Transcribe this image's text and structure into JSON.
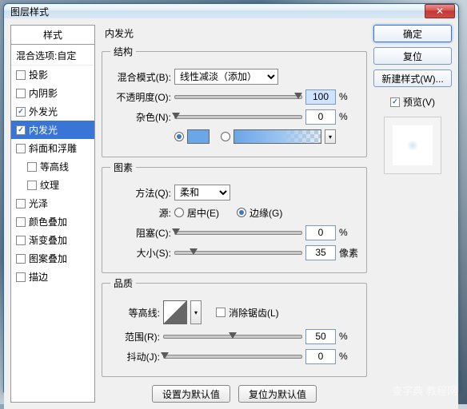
{
  "window": {
    "title": "图层样式"
  },
  "sidebar": {
    "header": "样式",
    "blend_option": "混合选项:自定",
    "items": [
      {
        "label": "投影",
        "checked": false
      },
      {
        "label": "内阴影",
        "checked": false
      },
      {
        "label": "外发光",
        "checked": true
      },
      {
        "label": "内发光",
        "checked": true,
        "active": true
      },
      {
        "label": "斜面和浮雕",
        "checked": false
      },
      {
        "label": "等高线",
        "checked": false,
        "sub": true
      },
      {
        "label": "纹理",
        "checked": false,
        "sub": true
      },
      {
        "label": "光泽",
        "checked": false
      },
      {
        "label": "颜色叠加",
        "checked": false
      },
      {
        "label": "渐变叠加",
        "checked": false
      },
      {
        "label": "图案叠加",
        "checked": false
      },
      {
        "label": "描边",
        "checked": false
      }
    ]
  },
  "main": {
    "title": "内发光",
    "structure": {
      "legend": "结构",
      "blend_mode_label": "混合模式(B):",
      "blend_mode_value": "线性减淡（添加）",
      "opacity_label": "不透明度(O):",
      "opacity_value": "100",
      "opacity_unit": "%",
      "noise_label": "杂色(N):",
      "noise_value": "0",
      "noise_unit": "%",
      "color_swatch": "#6aa6e8"
    },
    "elements": {
      "legend": "图素",
      "method_label": "方法(Q):",
      "method_value": "柔和",
      "source_label": "源:",
      "source_center": "居中(E)",
      "source_edge": "边缘(G)",
      "choke_label": "阻塞(C):",
      "choke_value": "0",
      "choke_unit": "%",
      "size_label": "大小(S):",
      "size_value": "35",
      "size_unit": "像素"
    },
    "quality": {
      "legend": "品质",
      "contour_label": "等高线:",
      "antialias_label": "消除锯齿(L)",
      "range_label": "范围(R):",
      "range_value": "50",
      "range_unit": "%",
      "jitter_label": "抖动(J):",
      "jitter_value": "0",
      "jitter_unit": "%"
    },
    "buttons": {
      "make_default": "设置为默认值",
      "reset_default": "复位为默认值"
    }
  },
  "right": {
    "ok": "确定",
    "cancel": "复位",
    "new_style": "新建样式(W)...",
    "preview": "预览(V)"
  },
  "watermark": "查字典 教程网"
}
